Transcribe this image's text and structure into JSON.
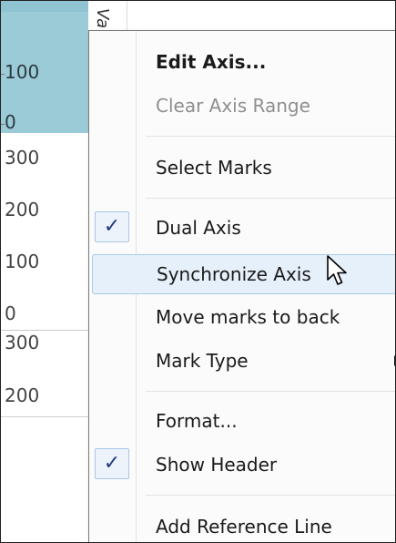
{
  "axis": {
    "ticks": [
      {
        "label": "100",
        "band": "top"
      },
      {
        "label": "0",
        "band": "top"
      },
      {
        "label": "300",
        "band": "middle"
      },
      {
        "label": "200",
        "band": "middle"
      },
      {
        "label": "100",
        "band": "middle"
      },
      {
        "label": "0",
        "band": "middle"
      },
      {
        "label": "300",
        "band": "bottom"
      },
      {
        "label": "200",
        "band": "bottom"
      }
    ],
    "top_band_color": "#9ccbd8",
    "header_glyph": "Va"
  },
  "menu": {
    "items": [
      {
        "label": "Edit Axis...",
        "style": "bold",
        "checked": false,
        "submenu": false
      },
      {
        "label": "Clear Axis Range",
        "style": "disabled",
        "checked": false,
        "submenu": false
      },
      {
        "label": "Select Marks",
        "style": "normal",
        "checked": false,
        "submenu": false
      },
      {
        "label": "Dual Axis",
        "style": "normal",
        "checked": true,
        "submenu": false
      },
      {
        "label": "Synchronize Axis",
        "style": "hovered",
        "checked": false,
        "submenu": false
      },
      {
        "label": "Move marks to back",
        "style": "normal",
        "checked": false,
        "submenu": false
      },
      {
        "label": "Mark Type",
        "style": "normal",
        "checked": false,
        "submenu": true
      },
      {
        "label": "Format...",
        "style": "normal",
        "checked": false,
        "submenu": false
      },
      {
        "label": "Show Header",
        "style": "normal",
        "checked": true,
        "submenu": false
      },
      {
        "label": "Add Reference Line",
        "style": "normal",
        "checked": false,
        "submenu": false
      }
    ],
    "check_glyph": "✓",
    "hover_color": "#e6f0fa",
    "check_color": "#1f3b82"
  },
  "cursor": {
    "icon": "mouse-pointer-icon"
  }
}
